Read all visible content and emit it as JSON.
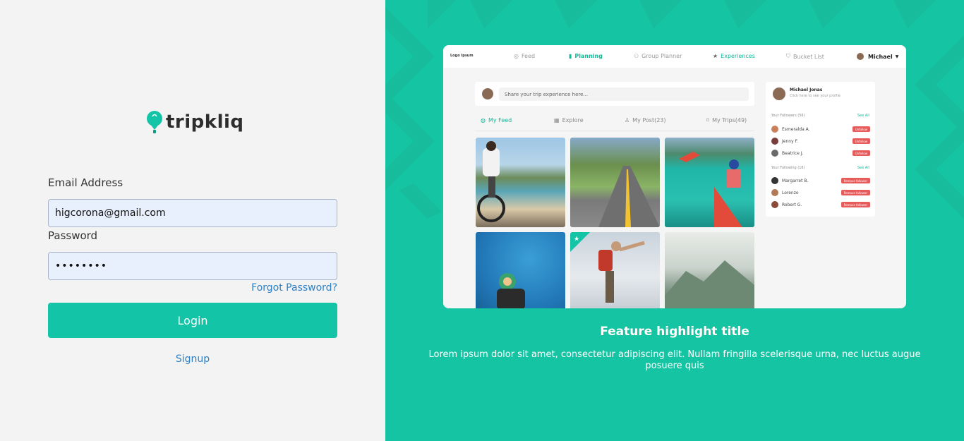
{
  "login": {
    "brand": "tripkliq",
    "email_label": "Email Address",
    "email_value": "higcorona@gmail.com",
    "password_label": "Password",
    "password_value": "••••••••",
    "forgot_label": "Forgot Password?",
    "login_label": "Login",
    "signup_label": "Signup"
  },
  "preview": {
    "logo_text": "Logo Ipsum",
    "nav": {
      "feed": "Feed",
      "planning": "Planning",
      "group_planner": "Group Planner",
      "experiences": "Experiences",
      "bucket_list": "Bucket List",
      "user": "Michael"
    },
    "share_placeholder": "Share your trip experience here...",
    "tabs": {
      "my_feed": "My Feed",
      "explore": "Explore",
      "my_post": "My Post(23)",
      "my_trips": "My Trips(49)"
    },
    "profile": {
      "name": "Michael Jonas",
      "subtitle": "Click here to see your profile"
    },
    "followers_title": "Your Followers (56)",
    "following_title": "Your Following (16)",
    "see_all": "See All",
    "followers": [
      {
        "name": "Esmeralda A.",
        "action": "Unfollow"
      },
      {
        "name": "Jenny F.",
        "action": "Unfollow"
      },
      {
        "name": "Beatrice J.",
        "action": "Unfollow"
      }
    ],
    "following": [
      {
        "name": "Margarret B.",
        "action": "Remove follower"
      },
      {
        "name": "Lorenzo",
        "action": "Remove follower"
      },
      {
        "name": "Robert G.",
        "action": "Remove follower"
      }
    ]
  },
  "feature": {
    "title": "Feature highlight title",
    "description": "Lorem ipsum dolor sit amet, consectetur adipiscing elit. Nullam fringilla scelerisque urna, nec luctus augue posuere quis"
  },
  "colors": {
    "accent": "#14c4a7",
    "link": "#2f80c4",
    "danger": "#e85b5b"
  }
}
